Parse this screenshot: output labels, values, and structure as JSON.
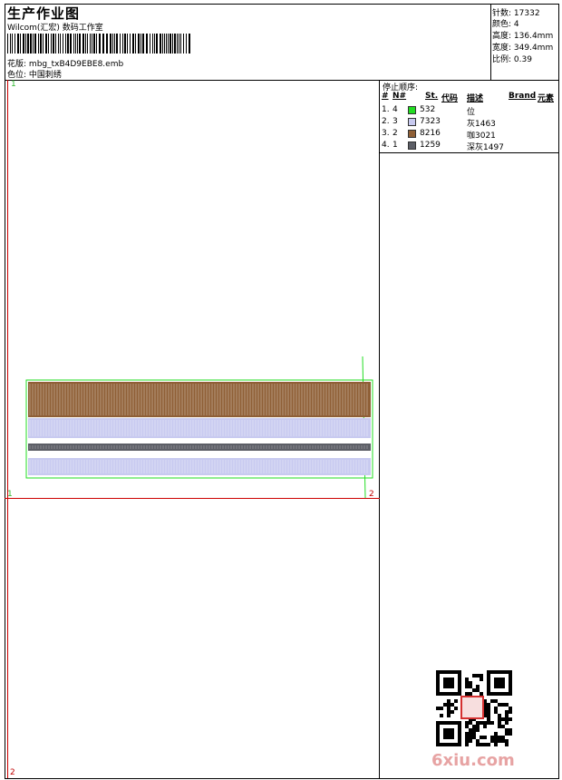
{
  "header": {
    "title": "生产作业图",
    "company": "Wilcom(汇宏) 数码工作室",
    "pattern_label": "花版:",
    "pattern_value": "mbg_txB4D9EBE8.emb",
    "color_label": "色位:",
    "color_value": "中国刺绣"
  },
  "stats": [
    {
      "label": "针数:",
      "value": "17332"
    },
    {
      "label": "颜色:",
      "value": "4"
    },
    {
      "label": "高度:",
      "value": "136.4mm"
    },
    {
      "label": "宽度:",
      "value": "349.4mm"
    },
    {
      "label": "比例:",
      "value": "0.39"
    }
  ],
  "stop_sequence": {
    "title": "停止顺序:",
    "headers": {
      "num": "#",
      "n": "N#",
      "st": "St.",
      "code": "代码",
      "desc": "描述",
      "brand": "Brand",
      "element": "元素"
    },
    "rows": [
      {
        "num": "1.",
        "n": "4",
        "color": "#22dd22",
        "code": "532",
        "desc": "位"
      },
      {
        "num": "2.",
        "n": "3",
        "color": "#c8caf0",
        "code": "7323",
        "desc": "灰1463"
      },
      {
        "num": "3.",
        "n": "2",
        "color": "#8f5f36",
        "code": "8216",
        "desc": "咖3021"
      },
      {
        "num": "4.",
        "n": "1",
        "color": "#5c5e66",
        "code": "1259",
        "desc": "深灰1497"
      }
    ]
  },
  "page_marks": {
    "top_left": "1",
    "mid_left": "1",
    "mid_right": "2",
    "bottom_left": "2"
  },
  "watermark": "6xiu.com",
  "colors": {
    "brown": "#8f5f36",
    "lavender": "#c8caf0",
    "dark_gray": "#5c5e66",
    "green": "#22dd22",
    "red_grid": "#cc0000"
  }
}
